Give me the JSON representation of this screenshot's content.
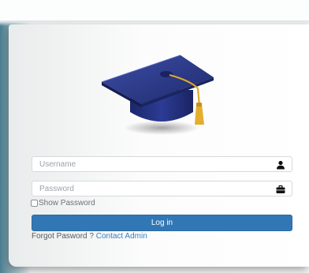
{
  "login": {
    "username_placeholder": "Username",
    "password_placeholder": "Password",
    "show_password_label": "Show Password",
    "login_button": "Log in",
    "forgot_text": "Forgot Pasword ?",
    "contact_admin": "Contact Admin"
  },
  "icons": {
    "logo": "graduation-cap",
    "username": "user-icon",
    "password": "briefcase-icon"
  },
  "colors": {
    "primary_button": "#3277b5",
    "link": "#3a7fc1",
    "cap": "#26337c",
    "tassel": "#e0a82a"
  }
}
